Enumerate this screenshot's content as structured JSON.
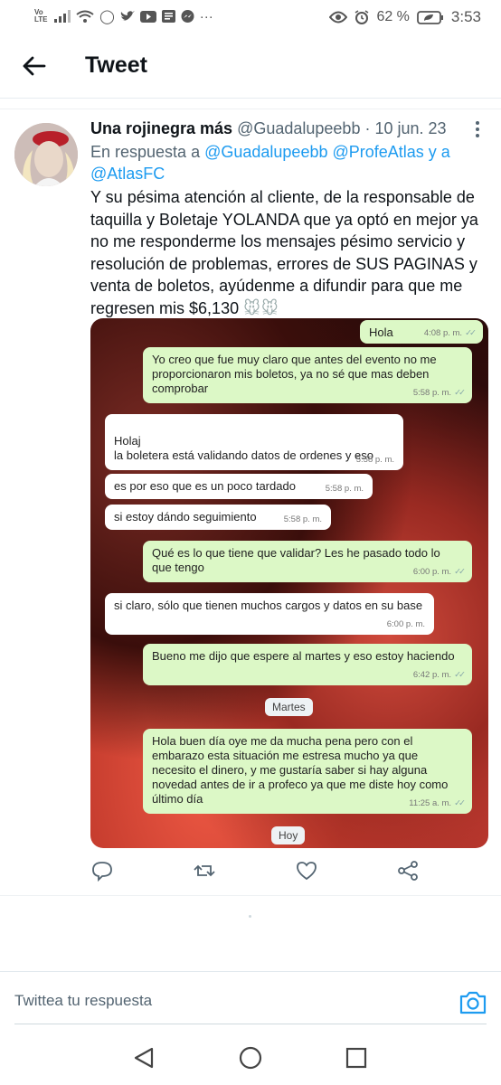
{
  "status_bar": {
    "volte": "Vo LTE",
    "battery": "62 %",
    "time": "3:53"
  },
  "header": {
    "title": "Tweet"
  },
  "tweet": {
    "author_name": "Una rojinegra más",
    "author_handle": "@Guadalupeebb",
    "date": "· 10 jun. 23",
    "reply_prefix": "En respuesta a",
    "reply_mentions": "@Guadalupeebb @ProfeAtlas y a @AtlasFC",
    "body": "Y su pésima atención al cliente, de la responsable de taquilla y Boletaje YOLANDA que ya optó en mejor ya no me responderme los mensajes pésimo servicio y resolución de problemas, errores de SUS PAGINAS y venta de boletos, ayúdenme a difundir para que me regresen mis $6,130",
    "emoji": "🐭🐭"
  },
  "chat": {
    "messages": [
      {
        "side": "out",
        "text": "Hola",
        "time": "4:08 p. m."
      },
      {
        "side": "out",
        "text": "Yo creo que fue muy claro que antes del evento no me proporcionaron mis boletos, ya no sé que mas deben comprobar",
        "time": "5:58 p. m."
      },
      {
        "side": "in",
        "text": "Holaj\nla boletera está validando datos de ordenes y eso",
        "time": "5:58 p. m."
      },
      {
        "side": "in",
        "text": "es por eso que es un poco tardado",
        "time": "5:58 p. m."
      },
      {
        "side": "in",
        "text": "si estoy dándo seguimiento",
        "time": "5:58 p. m."
      },
      {
        "side": "out",
        "text": "Qué es lo que tiene que validar? Les he pasado todo lo que tengo",
        "time": "6:00 p. m."
      },
      {
        "side": "in",
        "text": "si claro, sólo que tienen muchos cargos y datos en su base",
        "time": "6:00 p. m."
      },
      {
        "side": "out",
        "text": "Bueno me dijo que espere al martes y eso estoy haciendo",
        "time": "6:42 p. m."
      },
      {
        "side": "out",
        "text": "Hola buen día oye me da mucha pena pero con el embarazo esta situación me estresa mucho ya que necesito el dinero, y me gustaría saber si hay alguna novedad antes de ir a profeco ya que me diste hoy como último día",
        "time": "11:25 a. m."
      }
    ],
    "date_chips": [
      "Martes",
      "Hoy"
    ]
  },
  "reply": {
    "placeholder": "Twittea tu respuesta"
  },
  "colors": {
    "accent": "#1d9bf0",
    "text": "#0f1419",
    "secondary": "#536471",
    "bubble_out": "#dcf8c6"
  }
}
